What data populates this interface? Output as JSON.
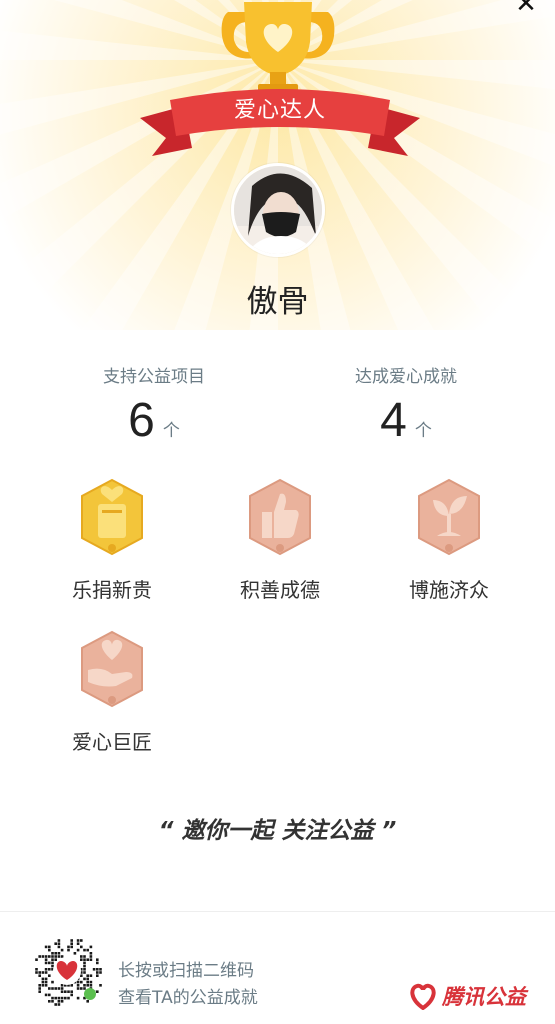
{
  "title_banner": "爱心达人",
  "user": {
    "name": "傲骨"
  },
  "stats": [
    {
      "label": "支持公益项目",
      "value": "6",
      "unit": "个"
    },
    {
      "label": "达成爱心成就",
      "value": "4",
      "unit": "个"
    }
  ],
  "badges": [
    {
      "label": "乐捐新贵",
      "icon": "gold-badge-icon",
      "color": "#f3c53a"
    },
    {
      "label": "积善成德",
      "icon": "thumbs-up-badge-icon",
      "color": "#e9a58c"
    },
    {
      "label": "博施济众",
      "icon": "sprout-badge-icon",
      "color": "#e9a58c"
    },
    {
      "label": "爱心巨匠",
      "icon": "heart-hand-badge-icon",
      "color": "#e9a58c"
    }
  ],
  "slogan": "“ 邀你一起 关注公益 ”",
  "footer": {
    "qr_line1": "长按或扫描二维码",
    "qr_line2": "查看TA的公益成就",
    "brand_name": "腾讯公益"
  },
  "colors": {
    "accent_red": "#d8333a",
    "gold": "#f5b21f",
    "badge_peach": "#e9a58c"
  }
}
